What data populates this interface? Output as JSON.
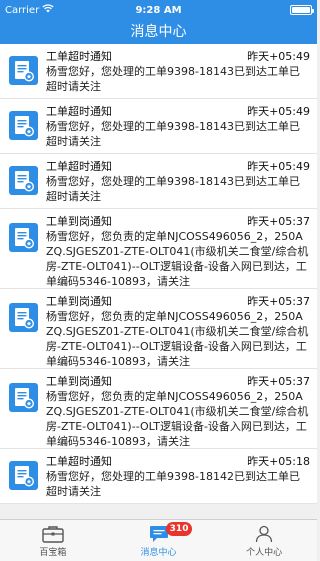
{
  "status_bar": {
    "carrier": "Carrier",
    "time": "9:28 AM"
  },
  "header": {
    "title": "消息中心"
  },
  "colors": {
    "primary": "#2e8ee6",
    "badge": "#e8342d"
  },
  "messages": [
    {
      "title": "工单超时通知",
      "time": "昨天+05:49",
      "body": "杨雪您好，您处理的工单9398-18143已到达工单已超时请关注",
      "icon": "document-icon"
    },
    {
      "title": "工单超时通知",
      "time": "昨天+05:49",
      "body": "杨雪您好，您处理的工单9398-18143已到达工单已超时请关注",
      "icon": "document-icon"
    },
    {
      "title": "工单超时通知",
      "time": "昨天+05:49",
      "body": "杨雪您好，您处理的工单9398-18143已到达工单已超时请关注",
      "icon": "document-icon"
    },
    {
      "title": "工单到岗通知",
      "time": "昨天+05:37",
      "body": "杨雪您好，您负责的定单NJCOSS496056_2，250AZQ.SJGESZ01-ZTE-OLT041(市级机关二食堂/综合机房-ZTE-OLT041)--OLT逻辑设备-设备入网已到达，工单编码5346-10893，请关注",
      "icon": "document-icon"
    },
    {
      "title": "工单到岗通知",
      "time": "昨天+05:37",
      "body": "杨雪您好，您负责的定单NJCOSS496056_2，250AZQ.SJGESZ01-ZTE-OLT041(市级机关二食堂/综合机房-ZTE-OLT041)--OLT逻辑设备-设备入网已到达，工单编码5346-10893，请关注",
      "icon": "document-icon"
    },
    {
      "title": "工单到岗通知",
      "time": "昨天+05:37",
      "body": "杨雪您好，您负责的定单NJCOSS496056_2，250AZQ.SJGESZ01-ZTE-OLT041(市级机关二食堂/综合机房-ZTE-OLT041)--OLT逻辑设备-设备入网已到达，工单编码5346-10893，请关注",
      "icon": "document-icon"
    },
    {
      "title": "工单超时通知",
      "time": "昨天+05:18",
      "body": "杨雪您好，您处理的工单9398-18142已到达工单已超时请关注",
      "icon": "document-icon"
    }
  ],
  "tabs": [
    {
      "label": "百宝箱",
      "icon": "toolbox-icon",
      "active": false
    },
    {
      "label": "消息中心",
      "icon": "chat-icon",
      "active": true,
      "badge": "310"
    },
    {
      "label": "个人中心",
      "icon": "person-icon",
      "active": false
    }
  ]
}
